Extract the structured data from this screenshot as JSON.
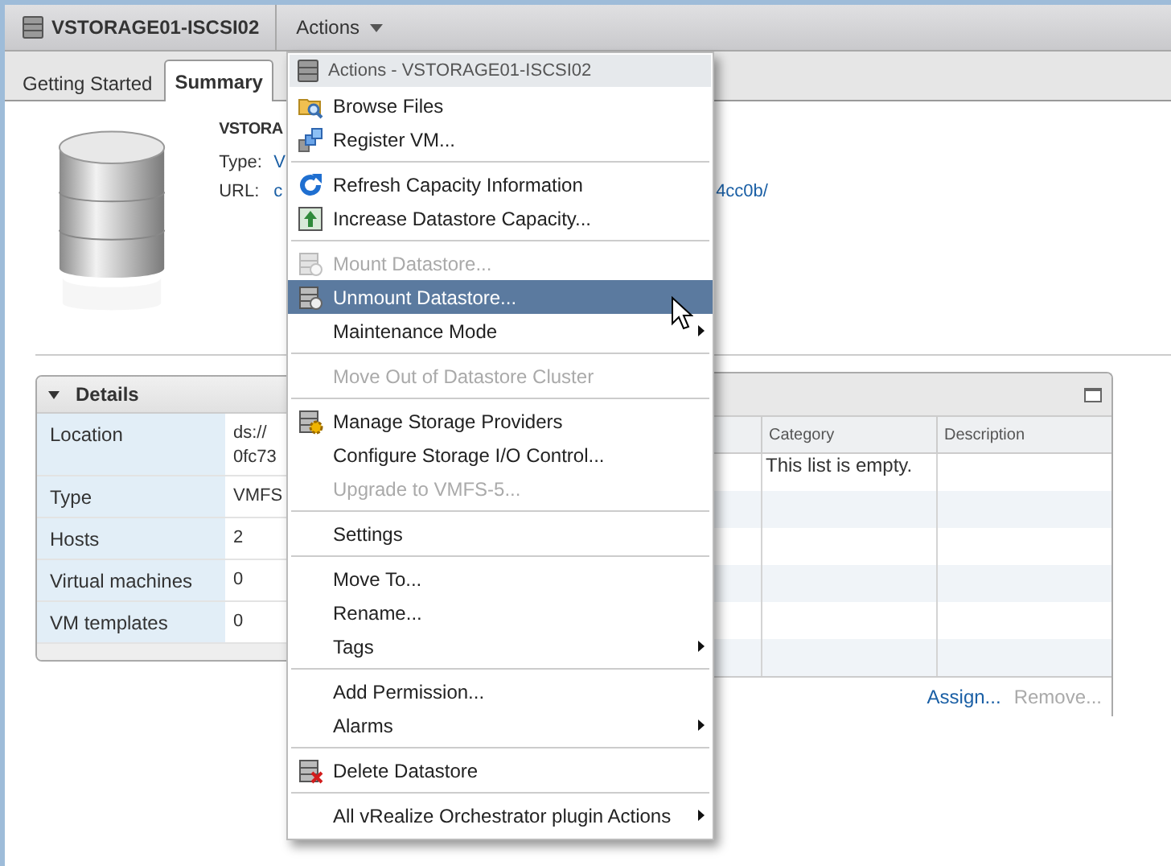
{
  "header": {
    "title": "VSTORAGE01-ISCSI02",
    "actions": "Actions"
  },
  "tabs": [
    {
      "label": "Getting Started",
      "selected": false
    },
    {
      "label": "Summary",
      "selected": true
    }
  ],
  "summary": {
    "name": "VSTORA",
    "fields": [
      {
        "label": "Type:",
        "value": "V"
      },
      {
        "label": "URL:",
        "value": "c",
        "value_tail": "4cc0b/"
      }
    ]
  },
  "details": {
    "title": "Details",
    "rows": [
      {
        "label": "Location",
        "lines": [
          "ds://",
          "0fc73"
        ]
      },
      {
        "label": "Type",
        "lines": [
          "VMFS"
        ]
      },
      {
        "label": "Hosts",
        "lines": [
          "2"
        ]
      },
      {
        "label": "Virtual machines",
        "lines": [
          "0"
        ]
      },
      {
        "label": "VM templates",
        "lines": [
          "0"
        ]
      }
    ]
  },
  "tags_panel": {
    "columns": [
      "Category",
      "Description"
    ],
    "empty_message": "This list is empty.",
    "buttons": [
      {
        "label": "Assign...",
        "disabled": false
      },
      {
        "label": "Remove...",
        "disabled": true
      }
    ]
  },
  "menu": {
    "title": "Actions - VSTORAGE01-ISCSI02",
    "items": [
      {
        "kind": "item",
        "label": "Browse Files",
        "disabled": false,
        "selected": false,
        "submenu": false
      },
      {
        "kind": "item",
        "label": "Register VM...",
        "disabled": false,
        "selected": false,
        "submenu": false
      },
      {
        "kind": "separator"
      },
      {
        "kind": "item",
        "label": "Refresh Capacity Information",
        "disabled": false,
        "selected": false,
        "submenu": false
      },
      {
        "kind": "item",
        "label": "Increase Datastore Capacity...",
        "disabled": false,
        "selected": false,
        "submenu": false
      },
      {
        "kind": "separator"
      },
      {
        "kind": "item",
        "label": "Mount Datastore...",
        "disabled": true,
        "selected": false,
        "submenu": false
      },
      {
        "kind": "item",
        "label": "Unmount Datastore...",
        "disabled": false,
        "selected": true,
        "submenu": false
      },
      {
        "kind": "item",
        "label": "Maintenance Mode",
        "disabled": false,
        "selected": false,
        "submenu": true
      },
      {
        "kind": "separator"
      },
      {
        "kind": "item",
        "label": "Move Out of Datastore Cluster",
        "disabled": true,
        "selected": false,
        "submenu": false
      },
      {
        "kind": "separator"
      },
      {
        "kind": "item",
        "label": "Manage Storage Providers",
        "disabled": false,
        "selected": false,
        "submenu": false
      },
      {
        "kind": "item",
        "label": "Configure Storage I/O Control...",
        "disabled": false,
        "selected": false,
        "submenu": false
      },
      {
        "kind": "item",
        "label": "Upgrade to VMFS-5...",
        "disabled": true,
        "selected": false,
        "submenu": false
      },
      {
        "kind": "separator"
      },
      {
        "kind": "item",
        "label": "Settings",
        "disabled": false,
        "selected": false,
        "submenu": false
      },
      {
        "kind": "separator"
      },
      {
        "kind": "item",
        "label": "Move To...",
        "disabled": false,
        "selected": false,
        "submenu": false
      },
      {
        "kind": "item",
        "label": "Rename...",
        "disabled": false,
        "selected": false,
        "submenu": false
      },
      {
        "kind": "item",
        "label": "Tags",
        "disabled": false,
        "selected": false,
        "submenu": true
      },
      {
        "kind": "separator"
      },
      {
        "kind": "item",
        "label": "Add Permission...",
        "disabled": false,
        "selected": false,
        "submenu": false
      },
      {
        "kind": "item",
        "label": "Alarms",
        "disabled": false,
        "selected": false,
        "submenu": true
      },
      {
        "kind": "separator"
      },
      {
        "kind": "item",
        "label": "Delete Datastore",
        "disabled": false,
        "selected": false,
        "submenu": false
      },
      {
        "kind": "separator"
      },
      {
        "kind": "item",
        "label": "All vRealize Orchestrator plugin Actions",
        "disabled": false,
        "selected": false,
        "submenu": true
      }
    ]
  }
}
